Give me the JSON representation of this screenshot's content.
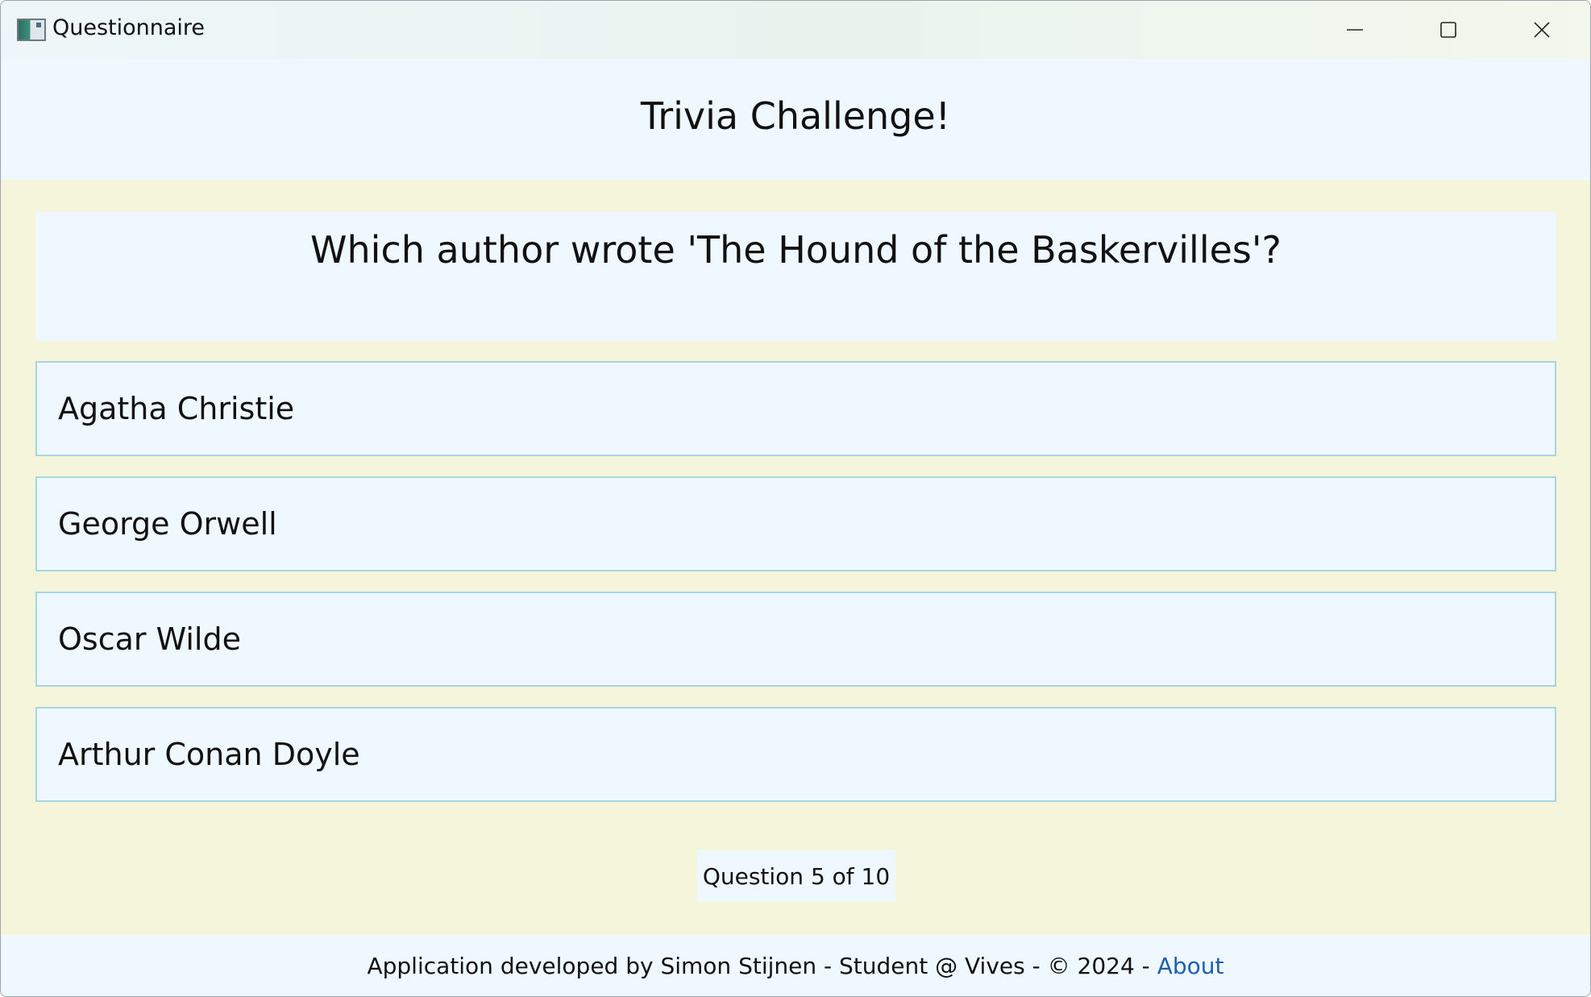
{
  "window": {
    "title": "Questionnaire",
    "controls": {
      "minimize_icon": "minimize-icon",
      "maximize_icon": "maximize-icon",
      "close_icon": "close-icon"
    }
  },
  "header": {
    "title": "Trivia Challenge!"
  },
  "question": {
    "text": "Which author wrote 'The Hound of the Baskervilles'?"
  },
  "answers": [
    {
      "label": "Agatha Christie"
    },
    {
      "label": "George Orwell"
    },
    {
      "label": "Oscar Wilde"
    },
    {
      "label": "Arthur Conan Doyle"
    }
  ],
  "progress": {
    "text": "Question 5 of 10",
    "current": 5,
    "total": 10
  },
  "footer": {
    "text": "Application developed by Simon Stijnen - Student @ Vives - © 2024 - ",
    "link_label": "About"
  },
  "colors": {
    "background": "#F5F5DC",
    "panel": "#F0F8FF",
    "answer_border": "#A6D6E0",
    "link": "#1A5FB4"
  }
}
